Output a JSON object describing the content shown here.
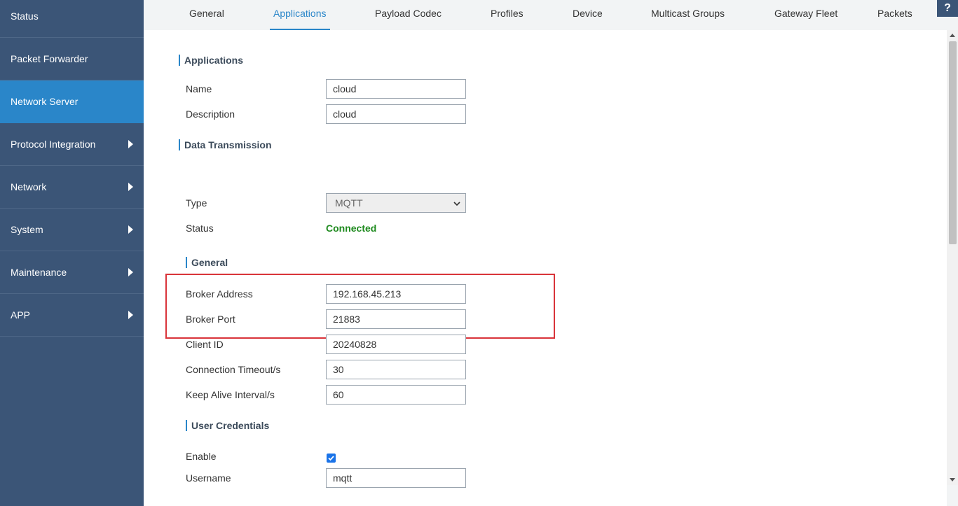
{
  "sidebar": {
    "items": [
      {
        "label": "Status",
        "has_arrow": false,
        "active": false
      },
      {
        "label": "Packet Forwarder",
        "has_arrow": false,
        "active": false
      },
      {
        "label": "Network Server",
        "has_arrow": false,
        "active": true
      },
      {
        "label": "Protocol Integration",
        "has_arrow": true,
        "active": false
      },
      {
        "label": "Network",
        "has_arrow": true,
        "active": false
      },
      {
        "label": "System",
        "has_arrow": true,
        "active": false
      },
      {
        "label": "Maintenance",
        "has_arrow": true,
        "active": false
      },
      {
        "label": "APP",
        "has_arrow": true,
        "active": false
      }
    ]
  },
  "tabs": [
    {
      "label": "General"
    },
    {
      "label": "Applications",
      "active": true
    },
    {
      "label": "Payload Codec"
    },
    {
      "label": "Profiles"
    },
    {
      "label": "Device"
    },
    {
      "label": "Multicast Groups"
    },
    {
      "label": "Gateway Fleet"
    },
    {
      "label": "Packets"
    }
  ],
  "help_label": "?",
  "applications": {
    "title": "Applications",
    "name_label": "Name",
    "name_value": "cloud",
    "description_label": "Description",
    "description_value": "cloud"
  },
  "data_transmission": {
    "title": "Data Transmission",
    "type_label": "Type",
    "type_value": "MQTT",
    "status_label": "Status",
    "status_value": "Connected"
  },
  "general": {
    "title": "General",
    "broker_address_label": "Broker Address",
    "broker_address_value": "192.168.45.213",
    "broker_port_label": "Broker Port",
    "broker_port_value": "21883",
    "client_id_label": "Client ID",
    "client_id_value": "20240828",
    "connection_timeout_label": "Connection Timeout/s",
    "connection_timeout_value": "30",
    "keep_alive_label": "Keep Alive Interval/s",
    "keep_alive_value": "60"
  },
  "user_credentials": {
    "title": "User Credentials",
    "enable_label": "Enable",
    "enable_checked": true,
    "username_label": "Username",
    "username_value": "mqtt"
  },
  "colors": {
    "sidebar_bg": "#3b5577",
    "sidebar_active": "#2a86c9",
    "accent": "#2a86c9",
    "status_connected": "#1e8a1e",
    "highlight_border": "#d9343a"
  },
  "icons": {
    "sidebar_arrow": "caret-right-icon",
    "select_chevron": "chevron-down-icon",
    "checkbox_check": "check-icon",
    "help": "question-icon"
  }
}
